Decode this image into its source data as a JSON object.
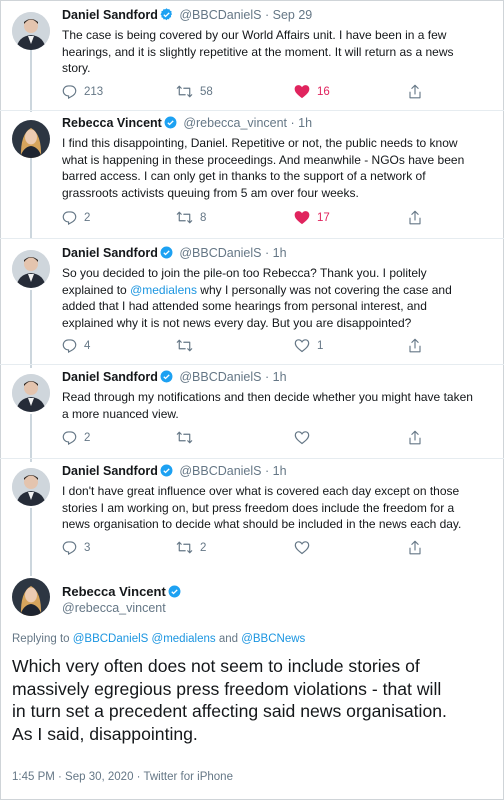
{
  "tweets": [
    {
      "name": "Daniel Sandford",
      "handle": "@BBCDanielS",
      "time": "Sep 29",
      "lines": [
        "The case is being covered by our World Affairs unit. I have been in a few",
        "hearings, and it is slightly repetitive at the moment. It will return as a news",
        "story."
      ],
      "replies": "213",
      "retweets": "58",
      "likes": "16"
    },
    {
      "name": "Rebecca Vincent",
      "handle": "@rebecca_vincent",
      "time": "1h",
      "lines": [
        "I find this disappointing, Daniel. Repetitive or not, the public needs to know",
        "what is happening in these proceedings. And meanwhile - NGOs have been",
        "barred access. I can only get in thanks to the support of a network of",
        "grassroots activists queuing from 5 am over four weeks."
      ],
      "replies": "2",
      "retweets": "8",
      "likes": "17"
    },
    {
      "name": "Daniel Sandford",
      "handle": "@BBCDanielS",
      "time": "1h",
      "lines": [
        "So you decided to join the pile-on too Rebecca? Thank you. I politely",
        "explained to ",
        "why I personally was not covering the case and",
        "added that I had attended some hearings from personal interest, and",
        "explained why it is not news every day. But you are disappointed?"
      ],
      "mention": "@medialens",
      "replies": "4",
      "retweets": "",
      "likes": "1"
    },
    {
      "name": "Daniel Sandford",
      "handle": "@BBCDanielS",
      "time": "1h",
      "lines": [
        "Read through my notifications and then decide whether you might have taken",
        "a more nuanced view."
      ],
      "replies": "2",
      "retweets": "",
      "likes": ""
    },
    {
      "name": "Daniel Sandford",
      "handle": "@BBCDanielS",
      "time": "1h",
      "lines": [
        "I don't have great influence over what is covered each day except on those",
        "stories I am working on, but press freedom does include the freedom for a",
        "news organisation to decide what should be included in the news each day."
      ],
      "replies": "3",
      "retweets": "2",
      "likes": ""
    }
  ],
  "main_tweet": {
    "name": "Rebecca Vincent",
    "handle": "@rebecca_vincent",
    "replying_prefix": "Replying to ",
    "replying_to": [
      "@BBCDanielS",
      "@medialens",
      "@BBCNews"
    ],
    "replying_and": " and ",
    "lines": [
      "Which very often does not seem to include stories of",
      "massively egregious press freedom violations - that will",
      "in turn set a precedent affecting said news organisation.",
      "As I said, disappointing."
    ],
    "meta": "1:45 PM · Sep 30, 2020 · Twitter for iPhone"
  },
  "sep_dot": "·",
  "icons": [
    "reply-icon",
    "retweet-icon",
    "like-icon",
    "share-icon",
    "verified-badge-icon"
  ],
  "colors": {
    "link": "#1b95e0",
    "like": "#e0245e",
    "muted": "#657786",
    "verified": "#1da1f2"
  }
}
